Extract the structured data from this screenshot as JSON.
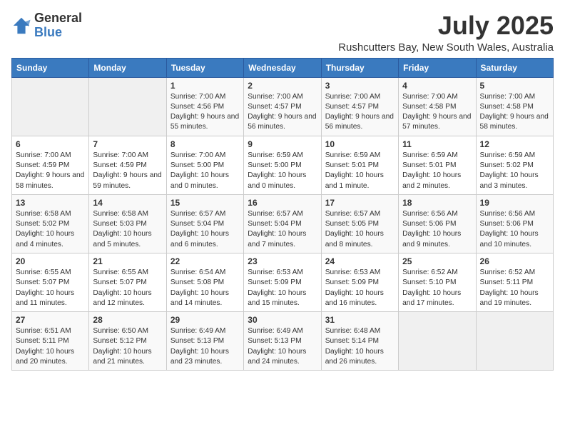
{
  "logo": {
    "general": "General",
    "blue": "Blue"
  },
  "title": "July 2025",
  "location": "Rushcutters Bay, New South Wales, Australia",
  "headers": [
    "Sunday",
    "Monday",
    "Tuesday",
    "Wednesday",
    "Thursday",
    "Friday",
    "Saturday"
  ],
  "weeks": [
    [
      {
        "day": "",
        "info": ""
      },
      {
        "day": "",
        "info": ""
      },
      {
        "day": "1",
        "info": "Sunrise: 7:00 AM\nSunset: 4:56 PM\nDaylight: 9 hours and 55 minutes."
      },
      {
        "day": "2",
        "info": "Sunrise: 7:00 AM\nSunset: 4:57 PM\nDaylight: 9 hours and 56 minutes."
      },
      {
        "day": "3",
        "info": "Sunrise: 7:00 AM\nSunset: 4:57 PM\nDaylight: 9 hours and 56 minutes."
      },
      {
        "day": "4",
        "info": "Sunrise: 7:00 AM\nSunset: 4:58 PM\nDaylight: 9 hours and 57 minutes."
      },
      {
        "day": "5",
        "info": "Sunrise: 7:00 AM\nSunset: 4:58 PM\nDaylight: 9 hours and 58 minutes."
      }
    ],
    [
      {
        "day": "6",
        "info": "Sunrise: 7:00 AM\nSunset: 4:59 PM\nDaylight: 9 hours and 58 minutes."
      },
      {
        "day": "7",
        "info": "Sunrise: 7:00 AM\nSunset: 4:59 PM\nDaylight: 9 hours and 59 minutes."
      },
      {
        "day": "8",
        "info": "Sunrise: 7:00 AM\nSunset: 5:00 PM\nDaylight: 10 hours and 0 minutes."
      },
      {
        "day": "9",
        "info": "Sunrise: 6:59 AM\nSunset: 5:00 PM\nDaylight: 10 hours and 0 minutes."
      },
      {
        "day": "10",
        "info": "Sunrise: 6:59 AM\nSunset: 5:01 PM\nDaylight: 10 hours and 1 minute."
      },
      {
        "day": "11",
        "info": "Sunrise: 6:59 AM\nSunset: 5:01 PM\nDaylight: 10 hours and 2 minutes."
      },
      {
        "day": "12",
        "info": "Sunrise: 6:59 AM\nSunset: 5:02 PM\nDaylight: 10 hours and 3 minutes."
      }
    ],
    [
      {
        "day": "13",
        "info": "Sunrise: 6:58 AM\nSunset: 5:02 PM\nDaylight: 10 hours and 4 minutes."
      },
      {
        "day": "14",
        "info": "Sunrise: 6:58 AM\nSunset: 5:03 PM\nDaylight: 10 hours and 5 minutes."
      },
      {
        "day": "15",
        "info": "Sunrise: 6:57 AM\nSunset: 5:04 PM\nDaylight: 10 hours and 6 minutes."
      },
      {
        "day": "16",
        "info": "Sunrise: 6:57 AM\nSunset: 5:04 PM\nDaylight: 10 hours and 7 minutes."
      },
      {
        "day": "17",
        "info": "Sunrise: 6:57 AM\nSunset: 5:05 PM\nDaylight: 10 hours and 8 minutes."
      },
      {
        "day": "18",
        "info": "Sunrise: 6:56 AM\nSunset: 5:06 PM\nDaylight: 10 hours and 9 minutes."
      },
      {
        "day": "19",
        "info": "Sunrise: 6:56 AM\nSunset: 5:06 PM\nDaylight: 10 hours and 10 minutes."
      }
    ],
    [
      {
        "day": "20",
        "info": "Sunrise: 6:55 AM\nSunset: 5:07 PM\nDaylight: 10 hours and 11 minutes."
      },
      {
        "day": "21",
        "info": "Sunrise: 6:55 AM\nSunset: 5:07 PM\nDaylight: 10 hours and 12 minutes."
      },
      {
        "day": "22",
        "info": "Sunrise: 6:54 AM\nSunset: 5:08 PM\nDaylight: 10 hours and 14 minutes."
      },
      {
        "day": "23",
        "info": "Sunrise: 6:53 AM\nSunset: 5:09 PM\nDaylight: 10 hours and 15 minutes."
      },
      {
        "day": "24",
        "info": "Sunrise: 6:53 AM\nSunset: 5:09 PM\nDaylight: 10 hours and 16 minutes."
      },
      {
        "day": "25",
        "info": "Sunrise: 6:52 AM\nSunset: 5:10 PM\nDaylight: 10 hours and 17 minutes."
      },
      {
        "day": "26",
        "info": "Sunrise: 6:52 AM\nSunset: 5:11 PM\nDaylight: 10 hours and 19 minutes."
      }
    ],
    [
      {
        "day": "27",
        "info": "Sunrise: 6:51 AM\nSunset: 5:11 PM\nDaylight: 10 hours and 20 minutes."
      },
      {
        "day": "28",
        "info": "Sunrise: 6:50 AM\nSunset: 5:12 PM\nDaylight: 10 hours and 21 minutes."
      },
      {
        "day": "29",
        "info": "Sunrise: 6:49 AM\nSunset: 5:13 PM\nDaylight: 10 hours and 23 minutes."
      },
      {
        "day": "30",
        "info": "Sunrise: 6:49 AM\nSunset: 5:13 PM\nDaylight: 10 hours and 24 minutes."
      },
      {
        "day": "31",
        "info": "Sunrise: 6:48 AM\nSunset: 5:14 PM\nDaylight: 10 hours and 26 minutes."
      },
      {
        "day": "",
        "info": ""
      },
      {
        "day": "",
        "info": ""
      }
    ]
  ]
}
